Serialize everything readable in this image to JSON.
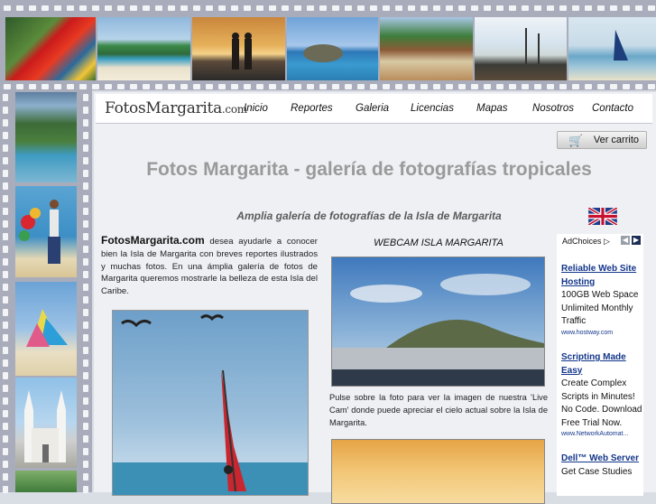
{
  "logo": {
    "main": "FotosMargarita",
    "suffix": ".com"
  },
  "nav": [
    "Inicio",
    "Reportes",
    "Galeria",
    "Licencias",
    "Mapas",
    "Nosotros",
    "Contacto"
  ],
  "cart_label": "Ver carrito",
  "page_title": "Fotos Margarita - galería de fotografías tropicales",
  "subtitle": "Amplia galería de fotografías de la Isla de Margarita",
  "intro": {
    "brand": "FotosMargarita.com",
    "text": " desea ayudarle a conocer bien la Isla de Margarita con breves reportes ilustrados y muchas fotos. En una ámplia galería de fotos de Margarita queremos mostrarle la belleza de esta Isla del Caribe."
  },
  "webcam": {
    "title": "WEBCAM ISLA MARGARITA",
    "caption": "Pulse sobre la foto para ver la imagen de nuestra 'Live Cam' donde puede apreciar el cielo actual sobre la Isla de Margarita."
  },
  "ads": {
    "adchoices": "AdChoices",
    "items": [
      {
        "title": "Reliable Web Site Hosting",
        "text": "100GB Web Space Unlimited Monthly Traffic",
        "url": "www.hostway.com"
      },
      {
        "title": "Scripting Made Easy",
        "text": "Create Complex Scripts in Minutes! No Code. Download Free Trial Now.",
        "url": "www.NetworkAutomat..."
      },
      {
        "title": "Dell™ Web Server",
        "text": "Get Case Studies",
        "url": ""
      }
    ]
  },
  "colors": {
    "film": "#a9acbb",
    "title_gray": "#9a9a9a",
    "ad_link": "#13368a"
  }
}
